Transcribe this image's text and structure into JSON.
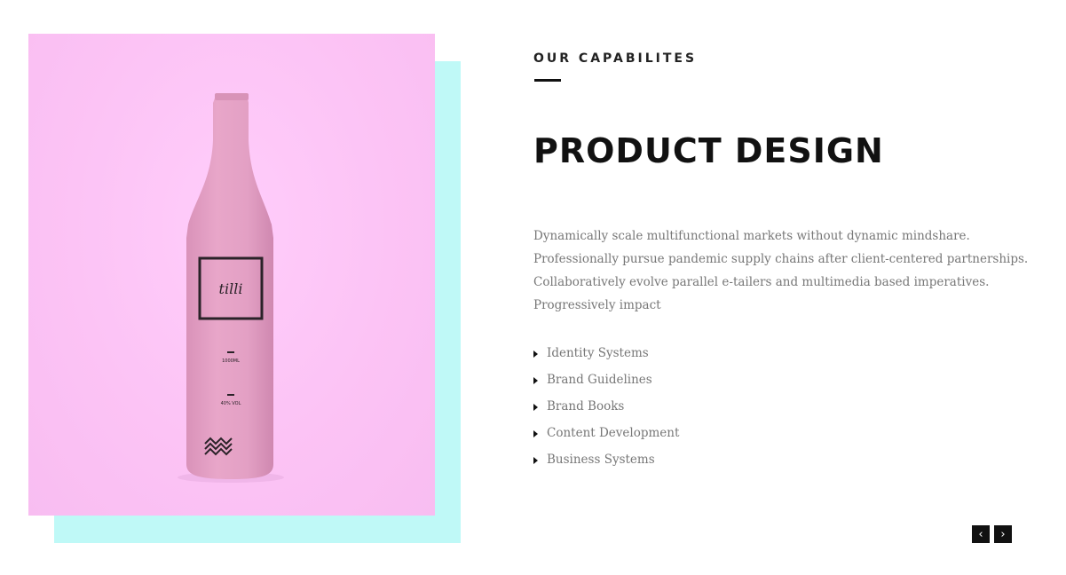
{
  "section": {
    "eyebrow": "OUR CAPABILITES",
    "title": "PRODUCT DESIGN",
    "description": [
      "Dynamically scale multifunctional markets without dynamic mindshare.",
      "Professionally pursue pandemic supply chains after client-centered partnerships.",
      "Collaboratively evolve parallel e-tailers and multimedia based imperatives.",
      "Progressively impact"
    ],
    "features": [
      "Identity Systems",
      "Brand Guidelines",
      "Brand Books",
      "Content Development",
      "Business Systems"
    ]
  },
  "image": {
    "label_text": "tilli",
    "volume_text": "1000ML",
    "abv_text": "40% VOL"
  },
  "nav": {
    "prev_icon": "‹",
    "next_icon": "›"
  },
  "colors": {
    "photo_background": "#fcc3f5",
    "accent_block": "#bff9f7",
    "bottle": "#e5a2c6",
    "nav_button": "#111111"
  }
}
